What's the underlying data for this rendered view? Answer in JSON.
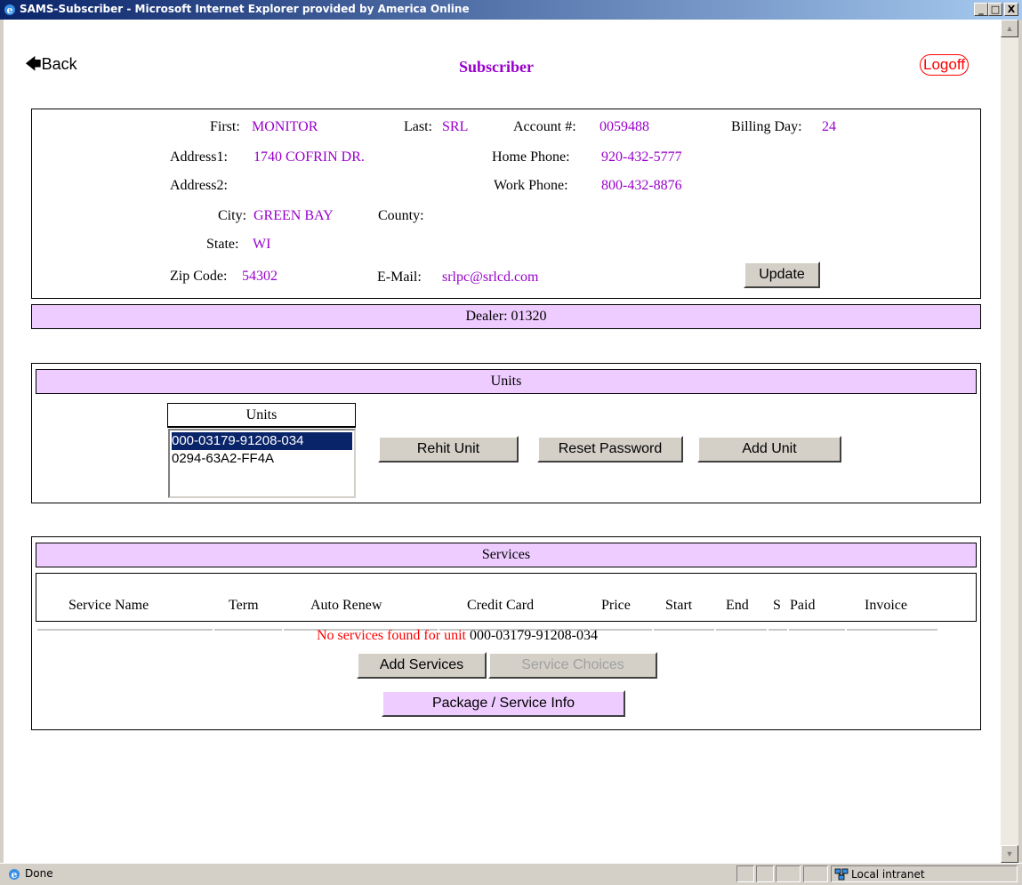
{
  "window": {
    "title": "SAMS-Subscriber - Microsoft Internet Explorer provided by America Online",
    "minimize_glyph": "_",
    "maximize_glyph": "□",
    "close_glyph": "X"
  },
  "nav": {
    "back_label": "Back",
    "page_title": "Subscriber",
    "logoff_label": "Logoff"
  },
  "subscriber": {
    "first_label": "First:",
    "first_value": "MONITOR",
    "last_label": "Last:",
    "last_value": "SRL",
    "account_label": "Account #:",
    "account_value": "0059488",
    "billing_day_label": "Billing Day:",
    "billing_day_value": "24",
    "address1_label": "Address1:",
    "address1_value": "1740 COFRIN DR.",
    "home_phone_label": "Home Phone:",
    "home_phone_value": "920-432-5777",
    "address2_label": "Address2:",
    "work_phone_label": "Work Phone:",
    "work_phone_value": "800-432-8876",
    "city_label": "City:",
    "city_value": "GREEN BAY",
    "county_label": "County:",
    "state_label": "State:",
    "state_value": "WI",
    "zip_label": "Zip Code:",
    "zip_value": "54302",
    "email_label": "E-Mail:",
    "email_value": "srlpc@srlcd.com",
    "update_label": "Update"
  },
  "dealer": {
    "text": "Dealer: 01320"
  },
  "units": {
    "section_title": "Units",
    "list_header": "Units",
    "items": [
      "000-03179-91208-034",
      "0294-63A2-FF4A"
    ],
    "selected_index": 0,
    "rehit_label": "Rehit Unit",
    "reset_password_label": "Reset Password",
    "add_unit_label": "Add Unit"
  },
  "services": {
    "section_title": "Services",
    "columns": [
      "Service Name",
      "Term",
      "Auto Renew",
      "Credit Card",
      "Price",
      "Start",
      "End",
      "S",
      "Paid",
      "Invoice"
    ],
    "empty_message": "No services found for unit",
    "empty_unit": "000-03179-91208-034",
    "add_services_label": "Add Services",
    "service_choices_label": "Service Choices",
    "package_info_label": "Package / Service Info"
  },
  "status": {
    "text": "Done",
    "zone": "Local intranet"
  },
  "colors": {
    "value_text": "#9900cc",
    "band_bg": "#eeccff",
    "error_text": "#ff0000",
    "titlebar_start": "#0a246a",
    "titlebar_end": "#a6caf0",
    "selection_bg": "#0a246a"
  }
}
